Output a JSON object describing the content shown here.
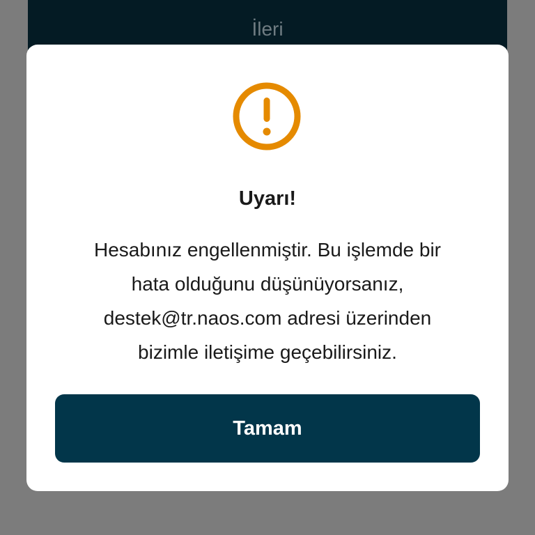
{
  "background_button": {
    "label": "İleri"
  },
  "dialog": {
    "icon": "exclamation-circle-icon",
    "icon_color": "#e58a00",
    "title": "Uyarı!",
    "message_lines": [
      "Hesabınız engellenmiştir. Bu işlemde bir",
      "hata olduğunu düşünüyorsanız,",
      "destek@tr.naos.com adresi üzerinden",
      "bizimle iletişime geçebilirsiniz."
    ],
    "ok_label": "Tamam",
    "ok_color": "#02364a"
  }
}
